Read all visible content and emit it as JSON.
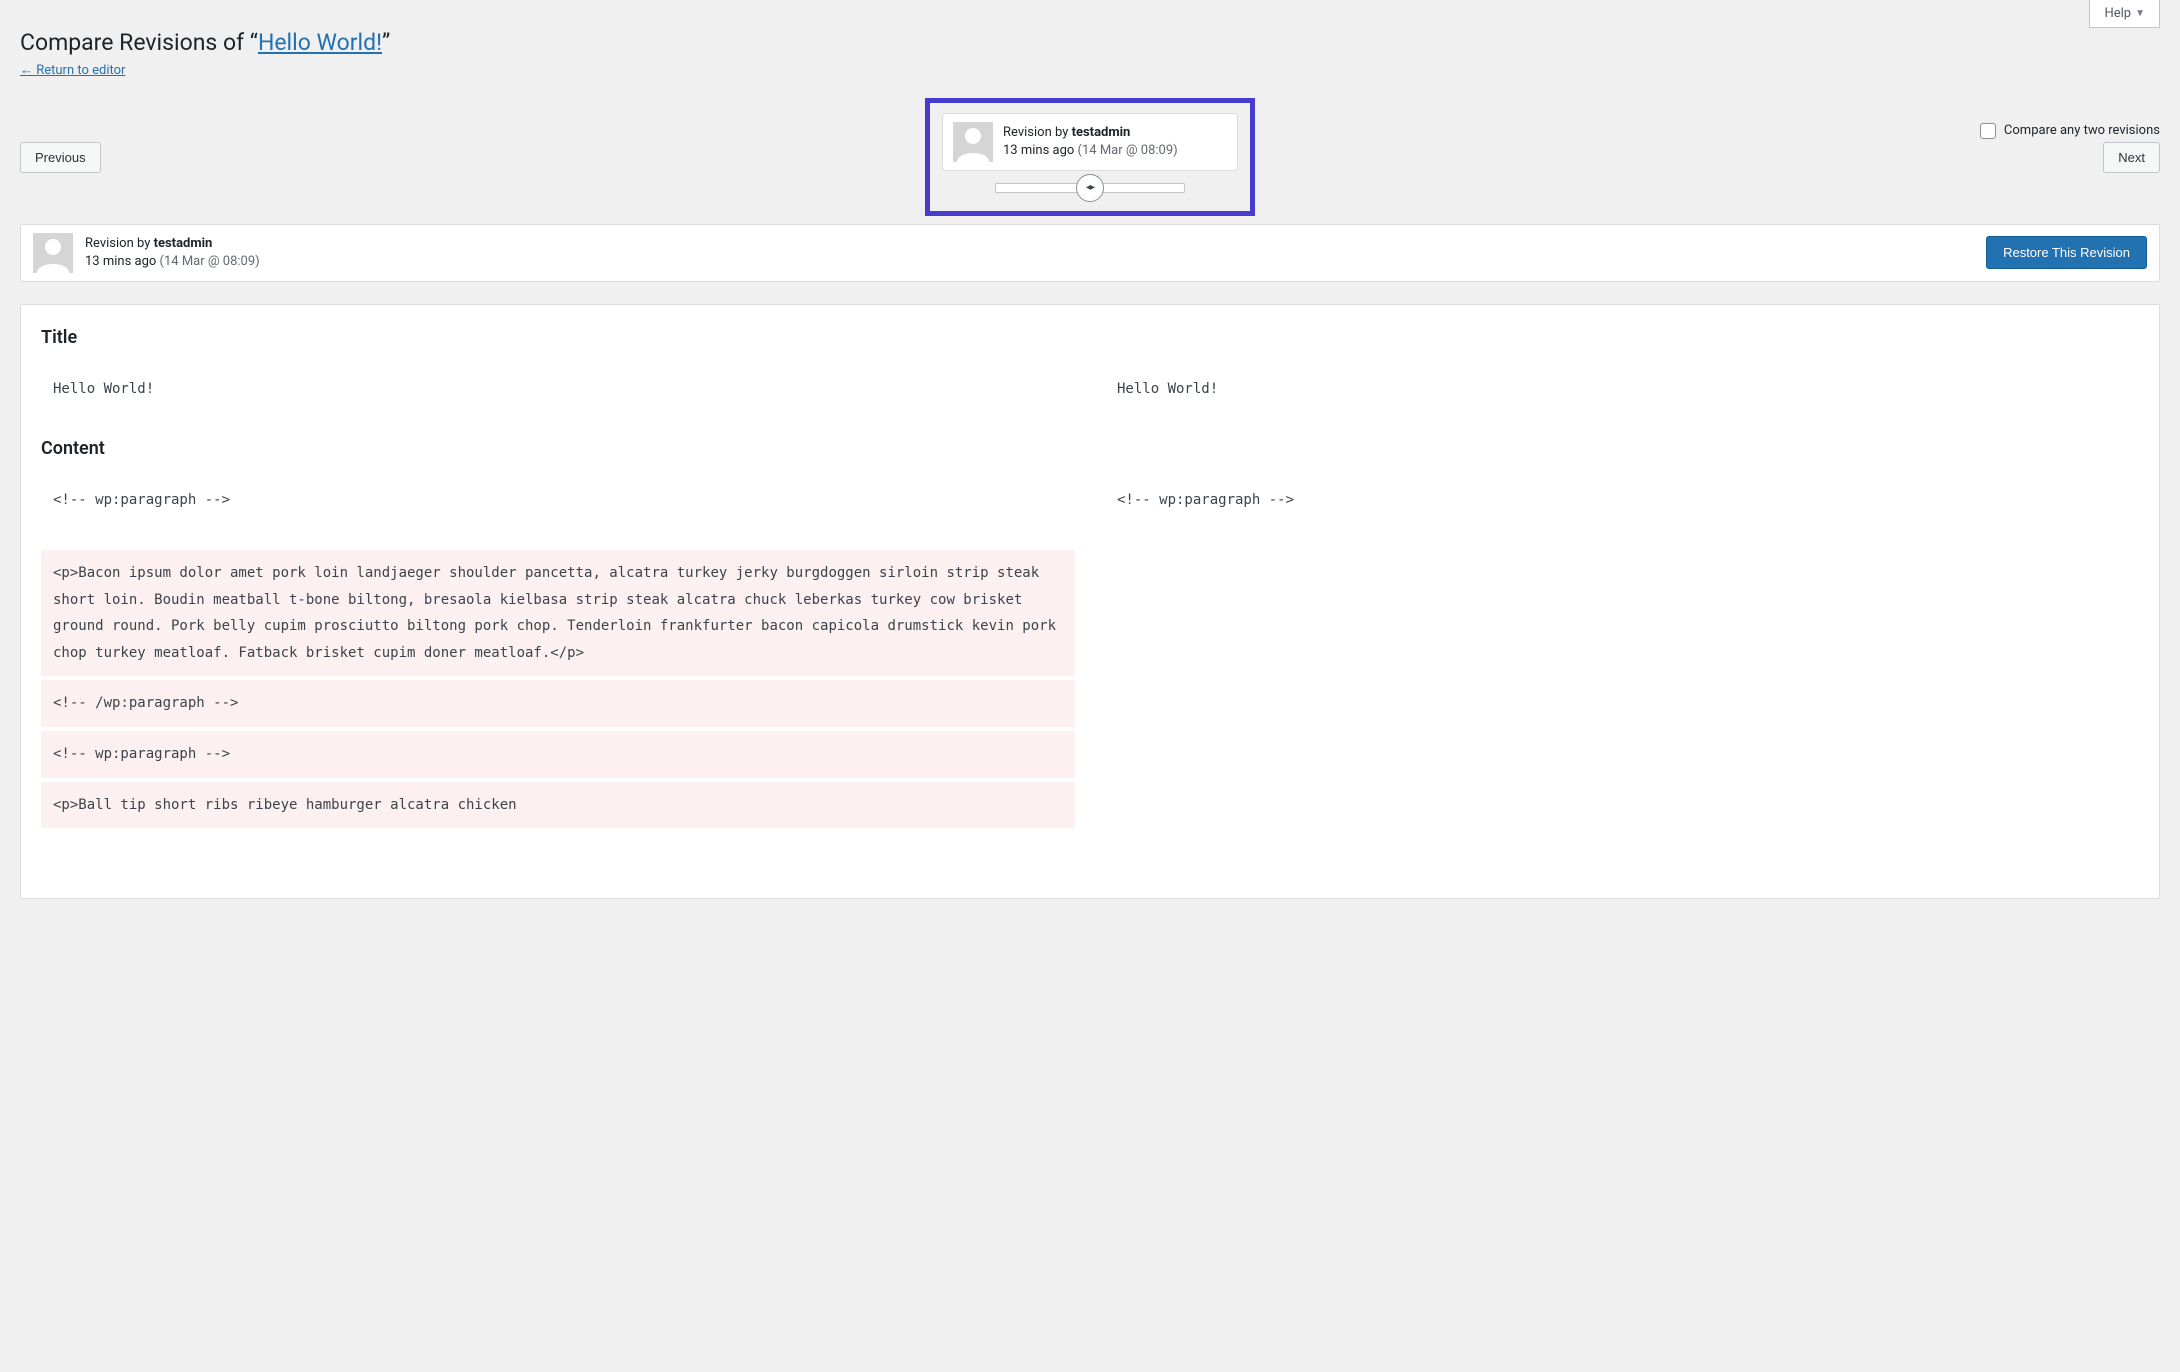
{
  "help_label": "Help",
  "page_title_prefix": "Compare Revisions of “",
  "page_title_link": "Hello World!",
  "page_title_suffix": "”",
  "return_link": "← Return to editor",
  "prev_label": "Previous",
  "next_label": "Next",
  "compare_label": "Compare any two revisions",
  "tooltip": {
    "by_prefix": "Revision by ",
    "author": "testadmin",
    "ago": "13 mins ago",
    "date": "(14 Mar @ 08:09)"
  },
  "meta": {
    "by_prefix": "Revision by ",
    "author": "testadmin",
    "ago": "13 mins ago",
    "date": "(14 Mar @ 08:09)",
    "restore_label": "Restore This Revision"
  },
  "sections": {
    "title_heading": "Title",
    "title_left": "Hello World!",
    "title_right": "Hello World!",
    "content_heading": "Content",
    "content_top_left": "<!-- wp:paragraph -->",
    "content_top_right": "<!-- wp:paragraph -->",
    "content_removed_1": "<p>Bacon ipsum dolor amet pork loin landjaeger shoulder pancetta, alcatra turkey jerky burgdoggen sirloin strip steak short loin. Boudin meatball t-bone biltong, bresaola kielbasa strip steak alcatra chuck leberkas turkey cow brisket ground round. Pork belly cupim prosciutto biltong pork chop. Tenderloin frankfurter bacon capicola drumstick kevin pork chop turkey meatloaf. Fatback brisket cupim doner meatloaf.</p>",
    "content_removed_2": "<!-- /wp:paragraph -->",
    "content_removed_3": "<!-- wp:paragraph -->",
    "content_removed_4": "<p>Ball tip short ribs ribeye hamburger alcatra chicken"
  }
}
